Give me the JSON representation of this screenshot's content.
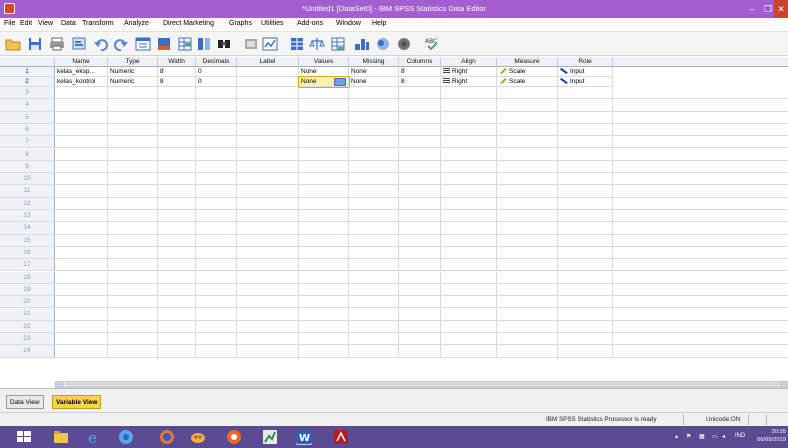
{
  "window": {
    "title": "*Untitled1 [DataSet0] - IBM SPSS Statistics Data Editor",
    "controls": [
      "–",
      "❐",
      "✕"
    ]
  },
  "menu": [
    "File",
    "Edit",
    "View",
    "Data",
    "Transform",
    "Analyze",
    "Direct Marketing",
    "Graphs",
    "Utilities",
    "Add-ons",
    "Window",
    "Help"
  ],
  "toolbar": [
    "open-icon",
    "save-icon",
    "print-icon",
    "dialog-recall-icon",
    "undo-icon",
    "redo-icon",
    "goto-case-icon",
    "goto-variable-icon",
    "variables-icon",
    "split-icon",
    "find-icon",
    "insert-cases-icon",
    "insert-variable-icon",
    "split-file-icon",
    "weight-cases-icon",
    "select-cases-icon",
    "value-labels-icon",
    "use-sets-icon",
    "show-all-icon",
    "spelling-icon"
  ],
  "columns": [
    "Name",
    "Type",
    "Width",
    "Decimals",
    "Label",
    "Values",
    "Missing",
    "Columns",
    "Align",
    "Measure",
    "Role"
  ],
  "variables": [
    {
      "num": "1",
      "name": "kelas_eksp...",
      "type": "Numeric",
      "width": "8",
      "decimals": "0",
      "label": "",
      "values": "None",
      "missing": "None",
      "columns": "8",
      "align": "Right",
      "measure": "Scale",
      "role": "Input"
    },
    {
      "num": "2",
      "name": "kelas_kontrol",
      "type": "Numeric",
      "width": "8",
      "decimals": "0",
      "label": "",
      "values": "None",
      "missing": "None",
      "columns": "8",
      "align": "Right",
      "measure": "Scale",
      "role": "Input"
    }
  ],
  "empty_rows": [
    "3",
    "4",
    "5",
    "6",
    "7",
    "8",
    "9",
    "10",
    "11",
    "12",
    "13",
    "14",
    "15",
    "16",
    "17",
    "18",
    "19",
    "20",
    "21",
    "22",
    "23",
    "24"
  ],
  "tabs": {
    "data_view": "Data View",
    "variable_view": "Variable View"
  },
  "status": {
    "processor": "IBM SPSS Statistics Processor is ready",
    "unicode": "Unicode:ON"
  },
  "taskbar": {
    "apps": [
      "windows-start-icon",
      "file-explorer-icon",
      "internet-explorer-icon",
      "chrome-icon",
      "firefox-icon",
      "paint-icon",
      "settings-icon",
      "excel-icon",
      "word-icon",
      "acrobat-icon"
    ],
    "tray": {
      "lang": "IND",
      "time": "20:35",
      "date": "06/09/2019"
    }
  },
  "colors": {
    "titlebar": "#a35fcf",
    "taskbar": "#5a4b93",
    "active_tab": "#f7d24a",
    "selected_cell": "#fff4a8"
  }
}
